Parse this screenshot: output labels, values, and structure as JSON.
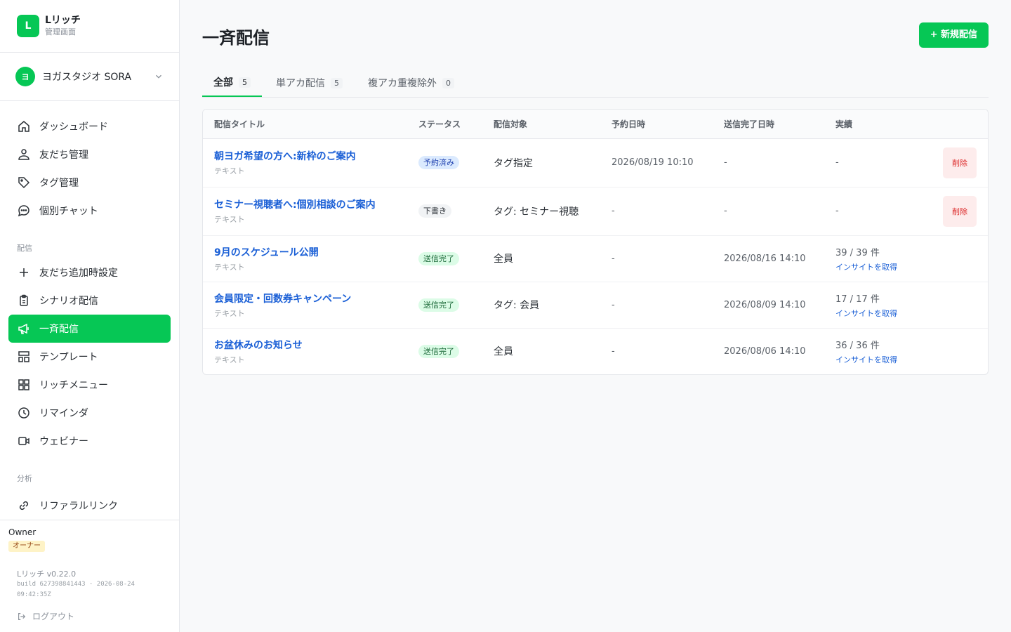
{
  "brand": {
    "logo_letter": "L",
    "name": "Lリッチ",
    "subtitle": "管理画面"
  },
  "account": {
    "avatar_letter": "ヨ",
    "name": "ヨガスタジオ SORA"
  },
  "sidebar": {
    "items": [
      {
        "label": "ダッシュボード",
        "icon": "home-icon"
      },
      {
        "label": "友だち管理",
        "icon": "users-icon"
      },
      {
        "label": "タグ管理",
        "icon": "tag-icon"
      },
      {
        "label": "個別チャット",
        "icon": "chat-icon"
      }
    ],
    "section_delivery": "配信",
    "delivery_items": [
      {
        "label": "友だち追加時設定",
        "icon": "plus-icon"
      },
      {
        "label": "シナリオ配信",
        "icon": "clipboard-icon"
      },
      {
        "label": "一斉配信",
        "icon": "megaphone-icon",
        "active": true
      },
      {
        "label": "テンプレート",
        "icon": "template-icon"
      },
      {
        "label": "リッチメニュー",
        "icon": "grid-icon"
      },
      {
        "label": "リマインダ",
        "icon": "clock-icon"
      },
      {
        "label": "ウェビナー",
        "icon": "video-icon"
      }
    ],
    "section_analysis": "分析",
    "analysis_items": [
      {
        "label": "リファラルリンク",
        "icon": "link-icon"
      }
    ]
  },
  "footer": {
    "owner_name": "Owner",
    "owner_role": "オーナー",
    "version": "Lリッチ v0.22.0",
    "build": "build 627398841443 · 2026-08-24 09:42:35Z",
    "logout": "ログアウト"
  },
  "page": {
    "title": "一斉配信",
    "new_button": "+ 新規配信"
  },
  "tabs": [
    {
      "label": "全部",
      "count": "5",
      "active": true
    },
    {
      "label": "単アカ配信",
      "count": "5"
    },
    {
      "label": "複アカ重複除外",
      "count": "0"
    }
  ],
  "table": {
    "headers": [
      "配信タイトル",
      "ステータス",
      "配信対象",
      "予約日時",
      "送信完了日時",
      "実績",
      ""
    ],
    "rows": [
      {
        "title": "朝ヨガ希望の方へ:新枠のご案内",
        "type": "テキスト",
        "status": "予約済み",
        "status_kind": "scheduled",
        "target": "タグ指定",
        "scheduled_at": "2026/08/19 10:10",
        "sent_at": "-",
        "result": "-",
        "insight": "",
        "delete": "削除"
      },
      {
        "title": "セミナー視聴者へ:個別相談のご案内",
        "type": "テキスト",
        "status": "下書き",
        "status_kind": "draft",
        "target": "タグ: セミナー視聴",
        "scheduled_at": "-",
        "sent_at": "-",
        "result": "-",
        "insight": "",
        "delete": "削除"
      },
      {
        "title": "9月のスケジュール公開",
        "type": "テキスト",
        "status": "送信完了",
        "status_kind": "sent",
        "target": "全員",
        "scheduled_at": "-",
        "sent_at": "2026/08/16 14:10",
        "result": "39 / 39 件",
        "insight": "インサイトを取得",
        "delete": ""
      },
      {
        "title": "会員限定・回数券キャンペーン",
        "type": "テキスト",
        "status": "送信完了",
        "status_kind": "sent",
        "target": "タグ: 会員",
        "scheduled_at": "-",
        "sent_at": "2026/08/09 14:10",
        "result": "17 / 17 件",
        "insight": "インサイトを取得",
        "delete": ""
      },
      {
        "title": "お盆休みのお知らせ",
        "type": "テキスト",
        "status": "送信完了",
        "status_kind": "sent",
        "target": "全員",
        "scheduled_at": "-",
        "sent_at": "2026/08/06 14:10",
        "result": "36 / 36 件",
        "insight": "インサイトを取得",
        "delete": ""
      }
    ]
  },
  "colors": {
    "accent": "#06c755",
    "link": "#1a5fd6",
    "danger": "#dc2626"
  }
}
